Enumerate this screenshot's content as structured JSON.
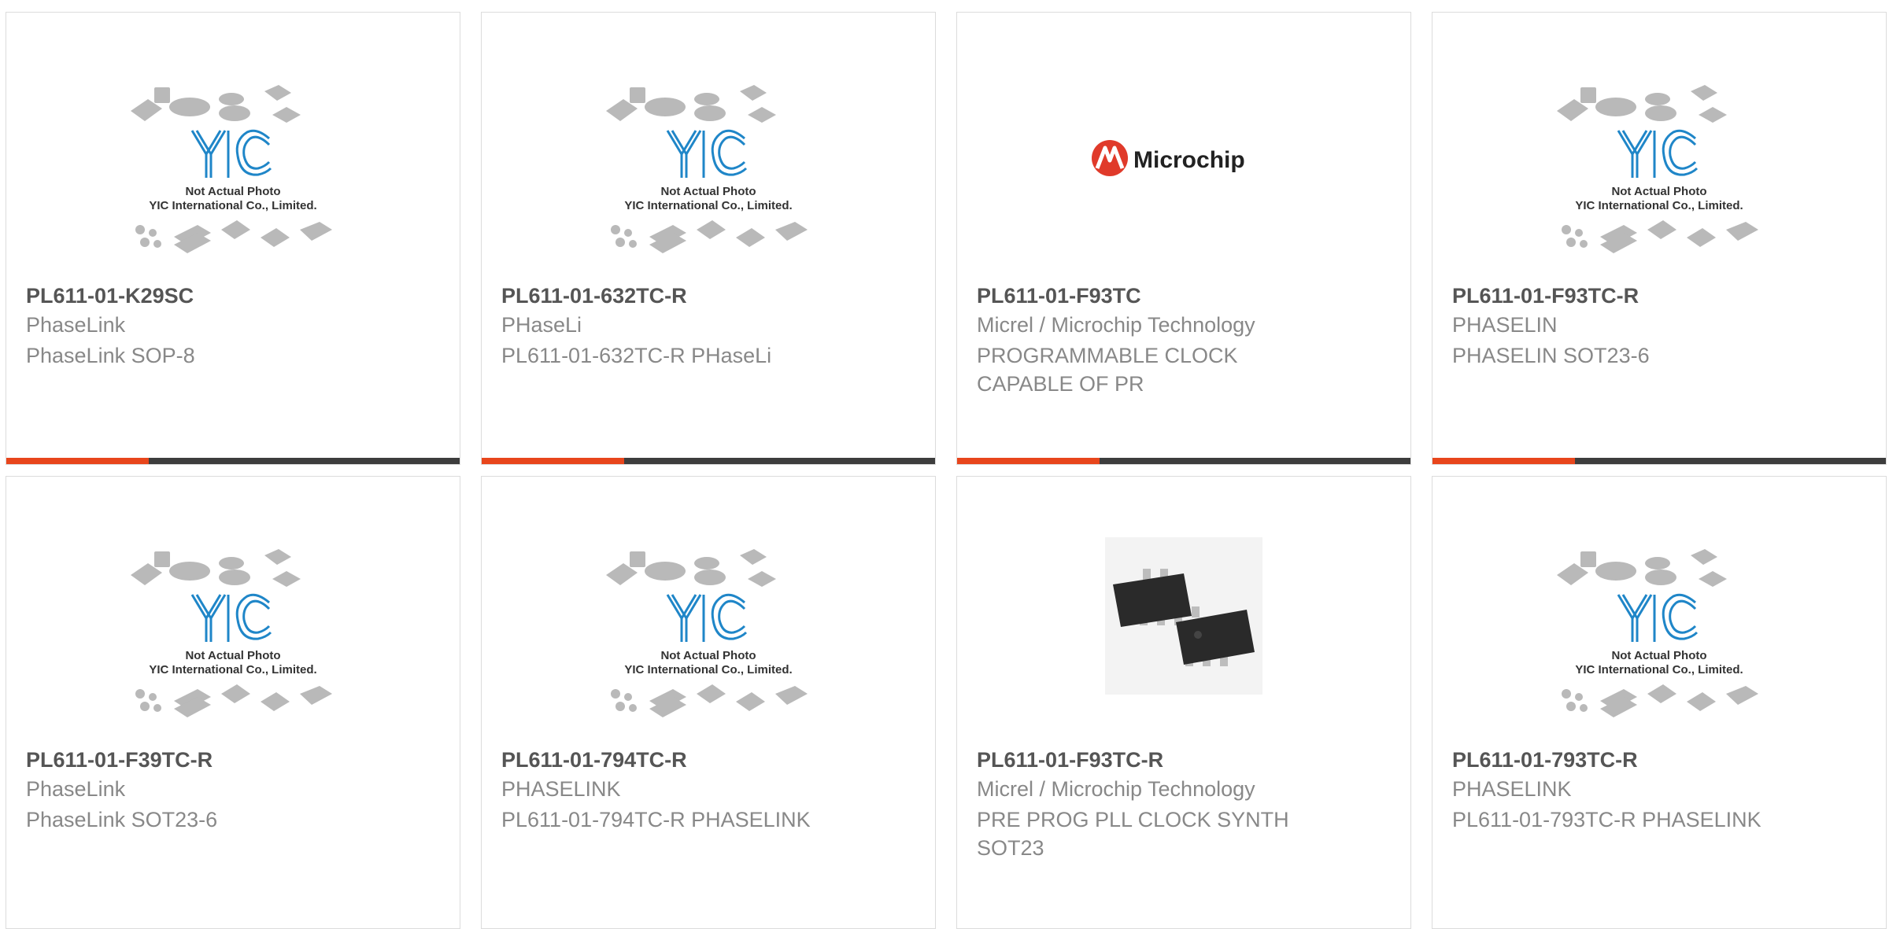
{
  "colors": {
    "accent": "#e8461c",
    "bar_dark": "#3d3d3d",
    "yic_blue": "#1f86c8",
    "microchip_red": "#e03a2a"
  },
  "placeholder_image": {
    "caption_line1": "Not Actual Photo",
    "caption_line2": "YIC International Co., Limited."
  },
  "products": [
    {
      "part": "PL611-01-K29SC",
      "manufacturer": "PhaseLink",
      "description": "PhaseLink SOP-8",
      "image": "yic-placeholder"
    },
    {
      "part": "PL611-01-632TC-R",
      "manufacturer": "PHaseLi",
      "description": "PL611-01-632TC-R PHaseLi",
      "image": "yic-placeholder"
    },
    {
      "part": "PL611-01-F93TC",
      "manufacturer": "Micrel / Microchip Technology",
      "description": "PROGRAMMABLE CLOCK CAPABLE OF PR",
      "image": "microchip-logo",
      "logo_text": "Microchip"
    },
    {
      "part": "PL611-01-F93TC-R",
      "manufacturer": "PHASELIN",
      "description": "PHASELIN SOT23-6",
      "image": "yic-placeholder"
    },
    {
      "part": "PL611-01-F39TC-R",
      "manufacturer": "PhaseLink",
      "description": "PhaseLink SOT23-6",
      "image": "yic-placeholder"
    },
    {
      "part": "PL611-01-794TC-R",
      "manufacturer": "PHASELINK",
      "description": "PL611-01-794TC-R PHASELINK",
      "image": "yic-placeholder"
    },
    {
      "part": "PL611-01-F93TC-R",
      "manufacturer": "Micrel / Microchip Technology",
      "description": "PRE PROG PLL CLOCK SYNTH SOT23",
      "image": "sot23-chip-photo"
    },
    {
      "part": "PL611-01-793TC-R",
      "manufacturer": "PHASELINK",
      "description": "PL611-01-793TC-R PHASELINK",
      "image": "yic-placeholder"
    }
  ]
}
